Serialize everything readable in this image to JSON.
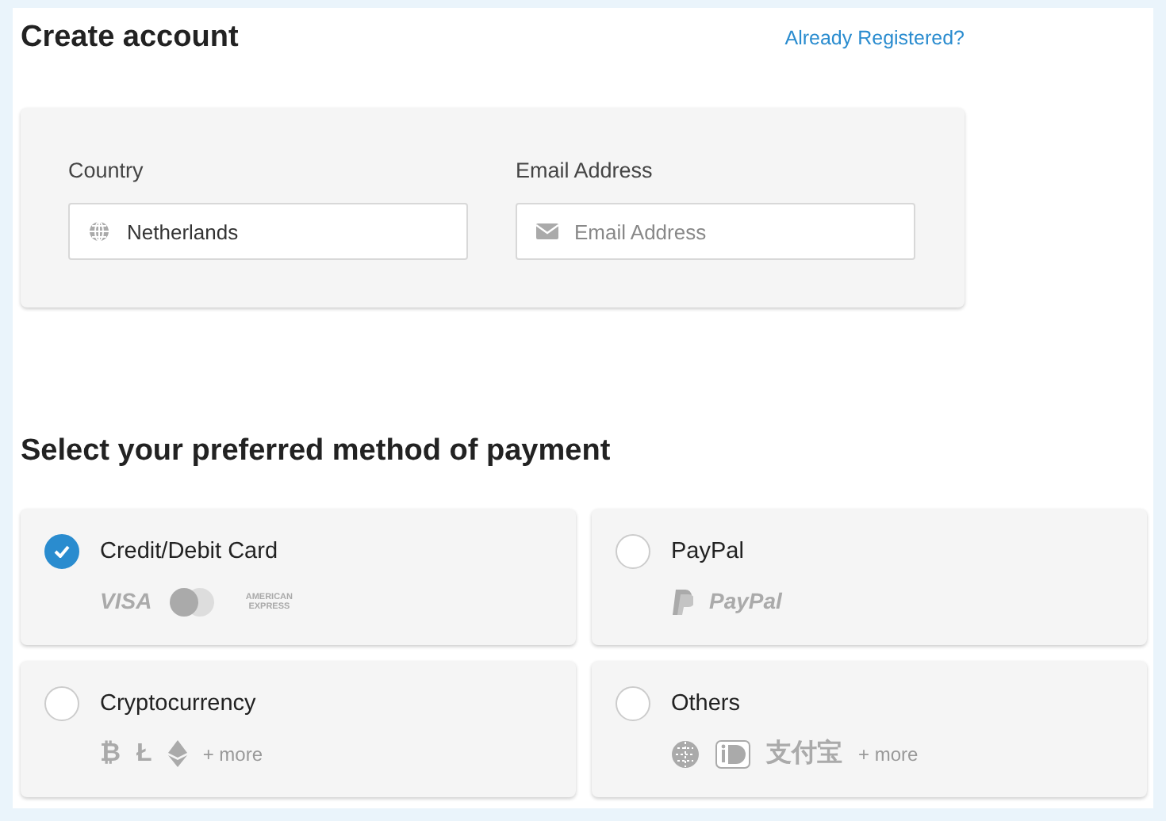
{
  "title": "Create account",
  "login_link": "Already Registered?",
  "fields": [
    {
      "label": "Country",
      "value": "Netherlands"
    },
    {
      "label": "Email Address",
      "placeholder": "Email Address"
    }
  ],
  "payment_heading": "Select your preferred method of payment",
  "methods": [
    {
      "label": "Credit/Debit Card",
      "selected": true,
      "logos": [
        {
          "kind": "wordmark",
          "text": "VISA"
        },
        {
          "kind": "circles"
        },
        {
          "kind": "stacked",
          "text": "AMERICAN EXPRESS"
        }
      ]
    },
    {
      "label": "PayPal",
      "selected": false,
      "logos": [
        {
          "kind": "pp"
        },
        {
          "kind": "wordmark",
          "text": "PayPal"
        }
      ]
    },
    {
      "label": "Cryptocurrency",
      "selected": false,
      "logos": [
        {
          "kind": "glyph",
          "text": "₿"
        },
        {
          "kind": "glyph",
          "text": "Ł"
        },
        {
          "kind": "diamond"
        },
        {
          "kind": "more",
          "text": "+ more"
        }
      ]
    },
    {
      "label": "Others",
      "selected": false,
      "logos": [
        {
          "kind": "globe"
        },
        {
          "kind": "badge"
        },
        {
          "kind": "cjk",
          "text": "支付宝"
        },
        {
          "kind": "more",
          "text": "+ more"
        }
      ]
    }
  ]
}
